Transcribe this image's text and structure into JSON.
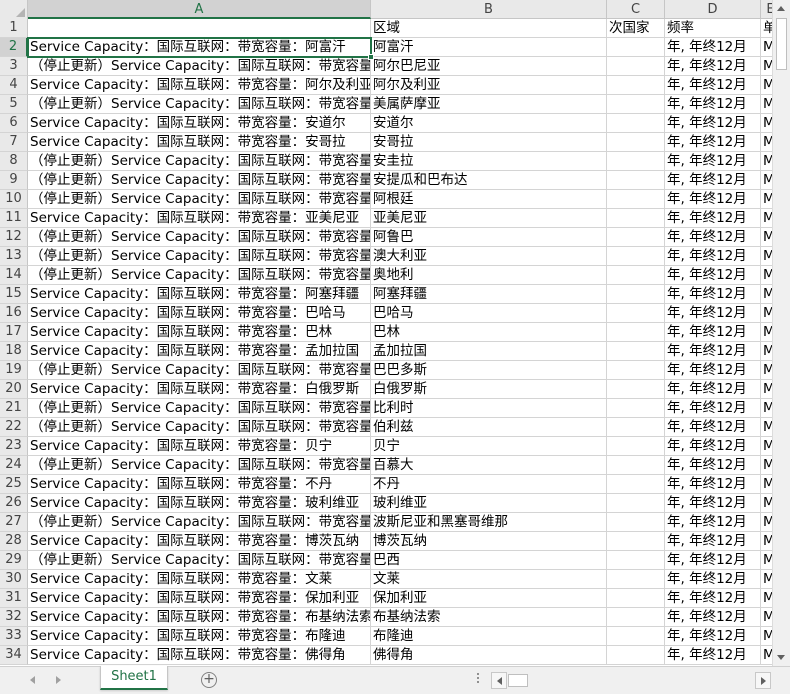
{
  "columns": [
    {
      "label": "A",
      "selected": true
    },
    {
      "label": "B",
      "selected": false
    },
    {
      "label": "C",
      "selected": false
    },
    {
      "label": "D",
      "selected": false
    },
    {
      "label": "E",
      "selected": false
    }
  ],
  "selected_row": "2",
  "header_row": {
    "row": "1",
    "a": "",
    "b": "区域",
    "c": "次国家",
    "d": "频率",
    "e": "单"
  },
  "rows": [
    {
      "row": "2",
      "a": "Service Capacity：国际互联网：带宽容量：阿富汗",
      "b": "阿富汗",
      "c": "",
      "d": "年, 年终12月",
      "e": "M"
    },
    {
      "row": "3",
      "a": "（停止更新）Service Capacity：国际互联网：带宽容量：阿尔巴尼亚",
      "b": "阿尔巴尼亚",
      "c": "",
      "d": "年, 年终12月",
      "e": "M"
    },
    {
      "row": "4",
      "a": "Service Capacity：国际互联网：带宽容量：阿尔及利亚",
      "b": "阿尔及利亚",
      "c": "",
      "d": "年, 年终12月",
      "e": "M"
    },
    {
      "row": "5",
      "a": "（停止更新）Service Capacity：国际互联网：带宽容量：美属萨摩亚",
      "b": "美属萨摩亚",
      "c": "",
      "d": "年, 年终12月",
      "e": "M"
    },
    {
      "row": "6",
      "a": "Service Capacity：国际互联网：带宽容量：安道尔",
      "b": "安道尔",
      "c": "",
      "d": "年, 年终12月",
      "e": "M"
    },
    {
      "row": "7",
      "a": "Service Capacity：国际互联网：带宽容量：安哥拉",
      "b": "安哥拉",
      "c": "",
      "d": "年, 年终12月",
      "e": "M"
    },
    {
      "row": "8",
      "a": "（停止更新）Service Capacity：国际互联网：带宽容量：安圭拉",
      "b": "安圭拉",
      "c": "",
      "d": "年, 年终12月",
      "e": "M"
    },
    {
      "row": "9",
      "a": "（停止更新）Service Capacity：国际互联网：带宽容量：安提瓜和巴布达",
      "b": "安提瓜和巴布达",
      "c": "",
      "d": "年, 年终12月",
      "e": "M"
    },
    {
      "row": "10",
      "a": "（停止更新）Service Capacity：国际互联网：带宽容量：阿根廷",
      "b": "阿根廷",
      "c": "",
      "d": "年, 年终12月",
      "e": "M"
    },
    {
      "row": "11",
      "a": "Service Capacity：国际互联网：带宽容量：亚美尼亚",
      "b": "亚美尼亚",
      "c": "",
      "d": "年, 年终12月",
      "e": "M"
    },
    {
      "row": "12",
      "a": "（停止更新）Service Capacity：国际互联网：带宽容量：阿鲁巴",
      "b": "阿鲁巴",
      "c": "",
      "d": "年, 年终12月",
      "e": "M"
    },
    {
      "row": "13",
      "a": "（停止更新）Service Capacity：国际互联网：带宽容量：澳大利亚",
      "b": "澳大利亚",
      "c": "",
      "d": "年, 年终12月",
      "e": "M"
    },
    {
      "row": "14",
      "a": "（停止更新）Service Capacity：国际互联网：带宽容量：奥地利",
      "b": "奥地利",
      "c": "",
      "d": "年, 年终12月",
      "e": "M"
    },
    {
      "row": "15",
      "a": "Service Capacity：国际互联网：带宽容量：阿塞拜疆",
      "b": "阿塞拜疆",
      "c": "",
      "d": "年, 年终12月",
      "e": "M"
    },
    {
      "row": "16",
      "a": "Service Capacity：国际互联网：带宽容量：巴哈马",
      "b": "巴哈马",
      "c": "",
      "d": "年, 年终12月",
      "e": "M"
    },
    {
      "row": "17",
      "a": "Service Capacity：国际互联网：带宽容量：巴林",
      "b": "巴林",
      "c": "",
      "d": "年, 年终12月",
      "e": "M"
    },
    {
      "row": "18",
      "a": "Service Capacity：国际互联网：带宽容量：孟加拉国",
      "b": "孟加拉国",
      "c": "",
      "d": "年, 年终12月",
      "e": "M"
    },
    {
      "row": "19",
      "a": "（停止更新）Service Capacity：国际互联网：带宽容量：巴巴多斯",
      "b": "巴巴多斯",
      "c": "",
      "d": "年, 年终12月",
      "e": "M"
    },
    {
      "row": "20",
      "a": "Service Capacity：国际互联网：带宽容量：白俄罗斯",
      "b": "白俄罗斯",
      "c": "",
      "d": "年, 年终12月",
      "e": "M"
    },
    {
      "row": "21",
      "a": "（停止更新）Service Capacity：国际互联网：带宽容量：比利时",
      "b": "比利时",
      "c": "",
      "d": "年, 年终12月",
      "e": "M"
    },
    {
      "row": "22",
      "a": "（停止更新）Service Capacity：国际互联网：带宽容量：伯利兹",
      "b": "伯利兹",
      "c": "",
      "d": "年, 年终12月",
      "e": "M"
    },
    {
      "row": "23",
      "a": "Service Capacity：国际互联网：带宽容量：贝宁",
      "b": "贝宁",
      "c": "",
      "d": "年, 年终12月",
      "e": "M"
    },
    {
      "row": "24",
      "a": "（停止更新）Service Capacity：国际互联网：带宽容量：百慕大",
      "b": "百慕大",
      "c": "",
      "d": "年, 年终12月",
      "e": "M"
    },
    {
      "row": "25",
      "a": "Service Capacity：国际互联网：带宽容量：不丹",
      "b": "不丹",
      "c": "",
      "d": "年, 年终12月",
      "e": "M"
    },
    {
      "row": "26",
      "a": "Service Capacity：国际互联网：带宽容量：玻利维亚",
      "b": "玻利维亚",
      "c": "",
      "d": "年, 年终12月",
      "e": "M"
    },
    {
      "row": "27",
      "a": "（停止更新）Service Capacity：国际互联网：带宽容量：波斯尼亚和黑塞哥维那",
      "b": "波斯尼亚和黑塞哥维那",
      "c": "",
      "d": "年, 年终12月",
      "e": "M"
    },
    {
      "row": "28",
      "a": "Service Capacity：国际互联网：带宽容量：博茨瓦纳",
      "b": "博茨瓦纳",
      "c": "",
      "d": "年, 年终12月",
      "e": "M"
    },
    {
      "row": "29",
      "a": "（停止更新）Service Capacity：国际互联网：带宽容量：巴西",
      "b": "巴西",
      "c": "",
      "d": "年, 年终12月",
      "e": "M"
    },
    {
      "row": "30",
      "a": "Service Capacity：国际互联网：带宽容量：文莱",
      "b": "文莱",
      "c": "",
      "d": "年, 年终12月",
      "e": "M"
    },
    {
      "row": "31",
      "a": "Service Capacity：国际互联网：带宽容量：保加利亚",
      "b": "保加利亚",
      "c": "",
      "d": "年, 年终12月",
      "e": "M"
    },
    {
      "row": "32",
      "a": "Service Capacity：国际互联网：带宽容量：布基纳法索",
      "b": "布基纳法索",
      "c": "",
      "d": "年, 年终12月",
      "e": "M"
    },
    {
      "row": "33",
      "a": "Service Capacity：国际互联网：带宽容量：布隆迪",
      "b": "布隆迪",
      "c": "",
      "d": "年, 年终12月",
      "e": "M"
    },
    {
      "row": "34",
      "a": "Service Capacity：国际互联网：带宽容量：佛得角",
      "b": "佛得角",
      "c": "",
      "d": "年, 年终12月",
      "e": "M"
    }
  ],
  "sheet_tabs": [
    {
      "label": "Sheet1",
      "active": true
    }
  ],
  "add_sheet_label": "+",
  "icons": {
    "scroll_up": "chevron-up-icon",
    "scroll_down": "chevron-down-icon",
    "scroll_left": "chevron-left-icon",
    "scroll_right": "chevron-right-icon",
    "add_sheet": "plus-circle-icon"
  },
  "colors": {
    "accent": "#217346",
    "header_bg": "#e9e9e9",
    "grid_line": "#d4d4d4"
  }
}
